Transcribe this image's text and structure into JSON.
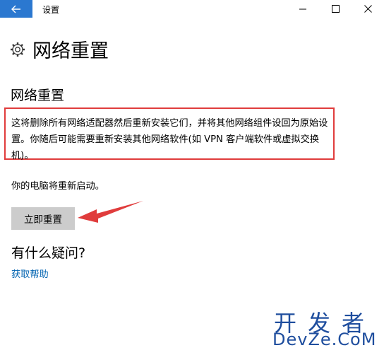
{
  "window": {
    "title": "设置"
  },
  "header": {
    "page_title": "网络重置"
  },
  "main": {
    "section_title": "网络重置",
    "description": "这将删除所有网络适配器然后重新安装它们，并将其他网络组件设回为原始设置。你随后可能需要重新安装其他网络软件(如 VPN 客户端软件或虚拟交换机)。",
    "restart_note": "你的电脑将重新启动。",
    "reset_button_label": "立即重置",
    "question_title": "有什么疑问?",
    "help_link": "获取帮助"
  },
  "watermark": {
    "line1": "开发者",
    "line2": "DevZe.CoM"
  },
  "colors": {
    "accent": "#2b78d0",
    "highlight_border": "#e03c3c",
    "link": "#0063b1",
    "button_bg": "#cccccc",
    "watermark": "#1f4e9e"
  },
  "icons": {
    "back": "back-arrow-icon",
    "header": "gear-icon",
    "minimize": "minimize-icon",
    "maximize": "maximize-icon",
    "close": "close-icon"
  }
}
